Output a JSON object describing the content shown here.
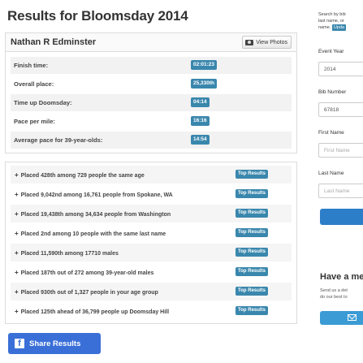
{
  "page": {
    "title": "Results for Bloomsday 2014"
  },
  "runner": {
    "name": "Nathan R Edminster",
    "view_photos_label": "View Photos"
  },
  "stats": [
    {
      "label": "Finish time:",
      "value": "02:01:23"
    },
    {
      "label": "Overall place:",
      "value": "25,330th"
    },
    {
      "label": "Time up Doomsday:",
      "value": "04:14"
    },
    {
      "label": "Pace per mile:",
      "value": "16:16"
    },
    {
      "label": "Average pace for 39-year-olds:",
      "value": "14:54"
    }
  ],
  "placings": [
    {
      "text": "Placed 428th among 729 people the same age",
      "button": "Top Results"
    },
    {
      "text": "Placed 9,042nd among 16,761 people from Spokane, WA",
      "button": "Top Results"
    },
    {
      "text": "Placed 19,438th among 34,634 people from Washington",
      "button": "Top Results"
    },
    {
      "text": "Placed 2nd among 10 people with the same last name",
      "button": "Top Results"
    },
    {
      "text": "Placed 11,590th among 17710 males",
      "button": "Top Results"
    },
    {
      "text": "Placed 187th out of 272 among 39-year-old males",
      "button": "Top Results"
    },
    {
      "text": "Placed 930th out of 1,327 people in your age group",
      "button": "Top Results"
    },
    {
      "text": "Placed 125th ahead of 36,799 people up Doomsday Hill",
      "button": "Top Results"
    }
  ],
  "placing_prefix": "+",
  "share": {
    "label": "Share Results",
    "icon": "f"
  },
  "sidebar": {
    "intro_line1": "Search by bib",
    "intro_line2": "last name, or",
    "intro_line3": "name.",
    "intro_badge": "Upda",
    "event_year_label": "Event Year",
    "event_year_value": "2014",
    "bib_label": "Bib Number",
    "bib_value": "67818",
    "first_name_label": "First Name",
    "first_name_placeholder": "First Name",
    "last_name_label": "Last Name",
    "last_name_placeholder": "Last Name",
    "promo_heading": "Have a me",
    "promo_line1": "Send us a det",
    "promo_line2": "do our best to"
  },
  "colors": {
    "badge": "#3a87ad",
    "share": "#3a6fd8",
    "search_button": "#2d7ec8",
    "mail_button": "#3a9bd5"
  }
}
